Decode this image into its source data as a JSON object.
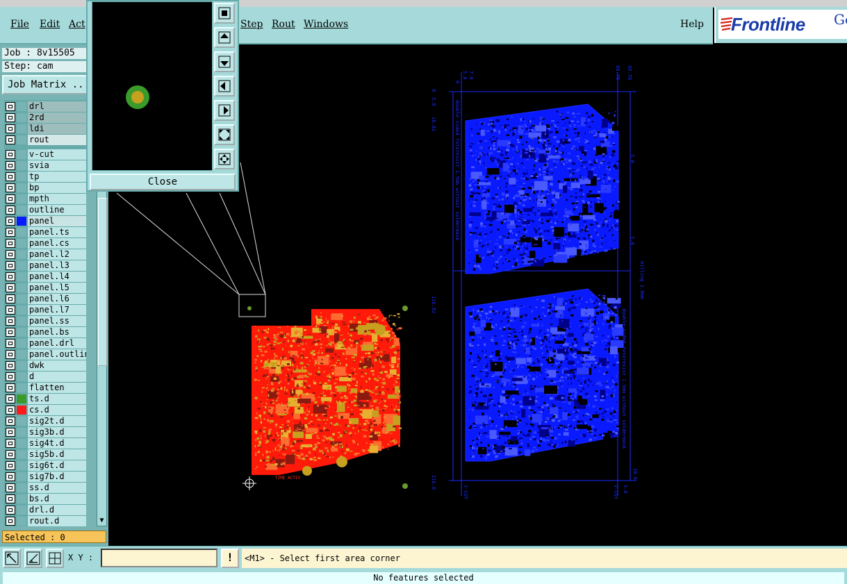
{
  "menu": {
    "items": [
      "File",
      "Edit",
      "Act",
      "Step",
      "Rout",
      "Windows"
    ],
    "help": "Help"
  },
  "brand": {
    "logo": "Frontline",
    "suffix": "Ge"
  },
  "info": {
    "job": "Job : 8v15505",
    "step": "Step: cam",
    "job_matrix": "Job Matrix ..."
  },
  "layers": [
    {
      "name": "drl",
      "color": ""
    },
    {
      "name": "2rd",
      "color": ""
    },
    {
      "name": "ldi",
      "color": ""
    },
    {
      "name": "rout",
      "color": ""
    },
    {
      "name": "v-cut",
      "color": ""
    },
    {
      "name": "svia",
      "color": ""
    },
    {
      "name": "tp",
      "color": ""
    },
    {
      "name": "bp",
      "color": ""
    },
    {
      "name": "mpth",
      "color": ""
    },
    {
      "name": "outline",
      "color": ""
    },
    {
      "name": "panel",
      "color": "#0a1aff"
    },
    {
      "name": "panel.ts",
      "color": ""
    },
    {
      "name": "panel.cs",
      "color": ""
    },
    {
      "name": "panel.l2",
      "color": ""
    },
    {
      "name": "panel.l3",
      "color": ""
    },
    {
      "name": "panel.l4",
      "color": ""
    },
    {
      "name": "panel.l5",
      "color": ""
    },
    {
      "name": "panel.l6",
      "color": ""
    },
    {
      "name": "panel.l7",
      "color": ""
    },
    {
      "name": "panel.ss",
      "color": ""
    },
    {
      "name": "panel.bs",
      "color": ""
    },
    {
      "name": "panel.drl",
      "color": ""
    },
    {
      "name": "panel.outline",
      "color": ""
    },
    {
      "name": "dwk",
      "color": ""
    },
    {
      "name": "d",
      "color": ""
    },
    {
      "name": "flatten",
      "color": ""
    },
    {
      "name": "ts.d",
      "color": "#3a9a2a"
    },
    {
      "name": "cs.d",
      "color": "#ff1a1a"
    },
    {
      "name": "sig2t.d",
      "color": ""
    },
    {
      "name": "sig3b.d",
      "color": ""
    },
    {
      "name": "sig4t.d",
      "color": ""
    },
    {
      "name": "sig5b.d",
      "color": ""
    },
    {
      "name": "sig6t.d",
      "color": ""
    },
    {
      "name": "sig7b.d",
      "color": ""
    },
    {
      "name": "ss.d",
      "color": ""
    },
    {
      "name": "bs.d",
      "color": ""
    },
    {
      "name": "drl.d",
      "color": ""
    },
    {
      "name": "rout.d",
      "color": ""
    }
  ],
  "selected": "Selected : 0",
  "popup": {
    "close_label": "Close"
  },
  "bottom": {
    "xy_label": "X Y :",
    "xy_value": "",
    "alert": "!",
    "prompt": "<M1> - Select first area corner"
  },
  "status": "No features selected",
  "drawing": {
    "dims_top": [
      "0",
      "5.0",
      "7.0",
      "88.70",
      "95.70"
    ],
    "dims_left": [
      "0",
      "5.0",
      "16.82",
      "116.82",
      "216.0"
    ],
    "dims_right": [
      "5.0",
      "5.0",
      "5.0",
      "10.0"
    ],
    "milling": "milling 2.0mm",
    "note1": "double-sided fotoresist 1.5mm without soldermask",
    "note2": "double-sided fotoresist 1.5mm without soldermask",
    "vcut": [
      "V-CUT",
      "V-CUT"
    ],
    "board_label": "TIME ACTIV",
    "colors": {
      "red_board": "#ff1a0a",
      "blue_board": "#0a1aff",
      "pad": "#c8a020",
      "pad_ring": "#3a9a2a"
    }
  }
}
